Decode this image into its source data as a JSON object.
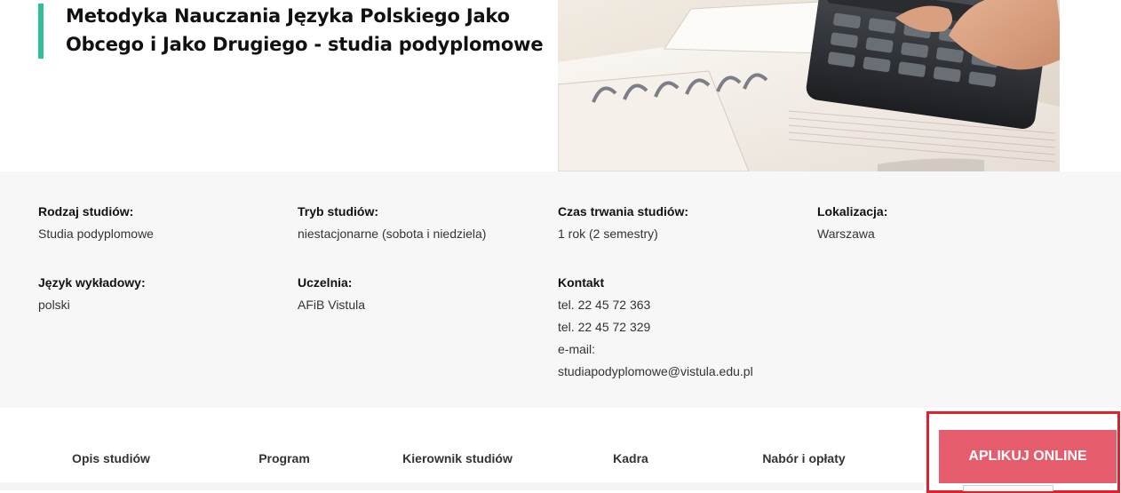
{
  "header": {
    "title": "Metodyka Nauczania Języka Polskiego Jako Obcego i Jako Drugiego - studia podyplomowe",
    "accent_color": "#2fc09a",
    "image": "hero-photo-calculator-notebook"
  },
  "info": {
    "study_type": {
      "label": "Rodzaj studiów:",
      "value": "Studia podyplomowe"
    },
    "study_mode": {
      "label": "Tryb studiów:",
      "value": "niestacjonarne (sobota i niedziela)"
    },
    "duration": {
      "label": "Czas trwania studiów:",
      "value": "1 rok (2 semestry)"
    },
    "location": {
      "label": "Lokalizacja:",
      "value": "Warszawa"
    },
    "language": {
      "label": "Język wykładowy:",
      "value": "polski"
    },
    "university": {
      "label": "Uczelnia:",
      "value": "AFiB Vistula"
    },
    "contact": {
      "label": "Kontakt",
      "phone1": "tel. 22 45 72 363",
      "phone2": "tel. 22 45 72 329",
      "email_label": "e-mail:",
      "email": "studiapodyplomowe@vistula.edu.pl"
    }
  },
  "tabs": [
    "Opis studiów",
    "Program",
    "Kierownik studiów",
    "Kadra",
    "Nabór i opłaty"
  ],
  "apply_button": {
    "label": "APLIKUJ ONLINE",
    "color": "#e55d6c"
  },
  "highlight_color": "#e3202a"
}
